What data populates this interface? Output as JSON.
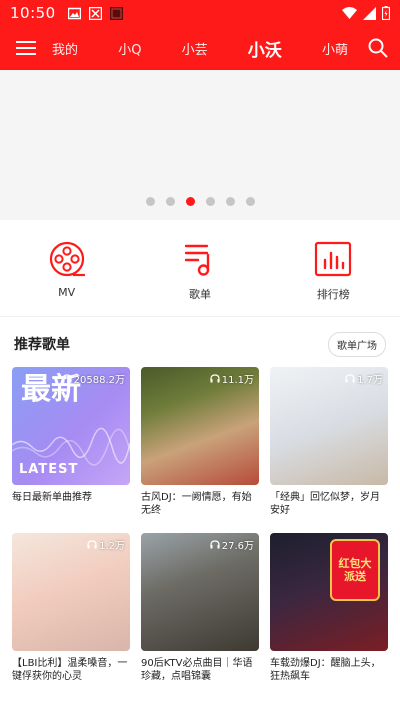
{
  "status": {
    "time": "10:50",
    "left_icons": [
      "image-icon",
      "box-icon",
      "square-icon"
    ],
    "right_icons": [
      "wifi-icon",
      "signal-icon",
      "battery-icon"
    ]
  },
  "nav": {
    "tabs": [
      {
        "label": "我的",
        "active": false
      },
      {
        "label": "小Q",
        "active": false
      },
      {
        "label": "小芸",
        "active": false
      },
      {
        "label": "小沃",
        "active": true
      },
      {
        "label": "小萌",
        "active": false
      }
    ]
  },
  "banner": {
    "dot_count": 6,
    "active_dot_index": 2
  },
  "quick": [
    {
      "label": "MV",
      "icon": "film-reel-icon"
    },
    {
      "label": "歌单",
      "icon": "playlist-icon"
    },
    {
      "label": "排行榜",
      "icon": "chart-icon"
    }
  ],
  "section": {
    "title": "推荐歌单",
    "more_label": "歌单广场"
  },
  "playlists": [
    {
      "plays": "20588.2万",
      "title": "每日最新单曲推荐",
      "cover_big": "最新",
      "cover_small": "LATEST",
      "badge": ""
    },
    {
      "plays": "11.1万",
      "title": "古风DJ：一阙情愿，有始无终",
      "cover_big": "",
      "cover_small": "",
      "badge": ""
    },
    {
      "plays": "1.7万",
      "title": "「经典」回忆似梦，岁月安好",
      "cover_big": "",
      "cover_small": "",
      "badge": ""
    },
    {
      "plays": "1.2万",
      "title": "【LBI比利】温柔嗓音，一键俘获你的心灵",
      "cover_big": "",
      "cover_small": "",
      "badge": ""
    },
    {
      "plays": "27.6万",
      "title": "90后KTV必点曲目｜华语珍藏，点唱锦囊",
      "cover_big": "",
      "cover_small": "",
      "badge": ""
    },
    {
      "plays": "",
      "title": "车载劲爆DJ：醒脑上头，狂热飙车",
      "cover_big": "",
      "cover_small": "",
      "badge": "红包大派送"
    }
  ],
  "colors": {
    "brand": "#ff1a1a",
    "dot_inactive": "#c6c6c6"
  }
}
